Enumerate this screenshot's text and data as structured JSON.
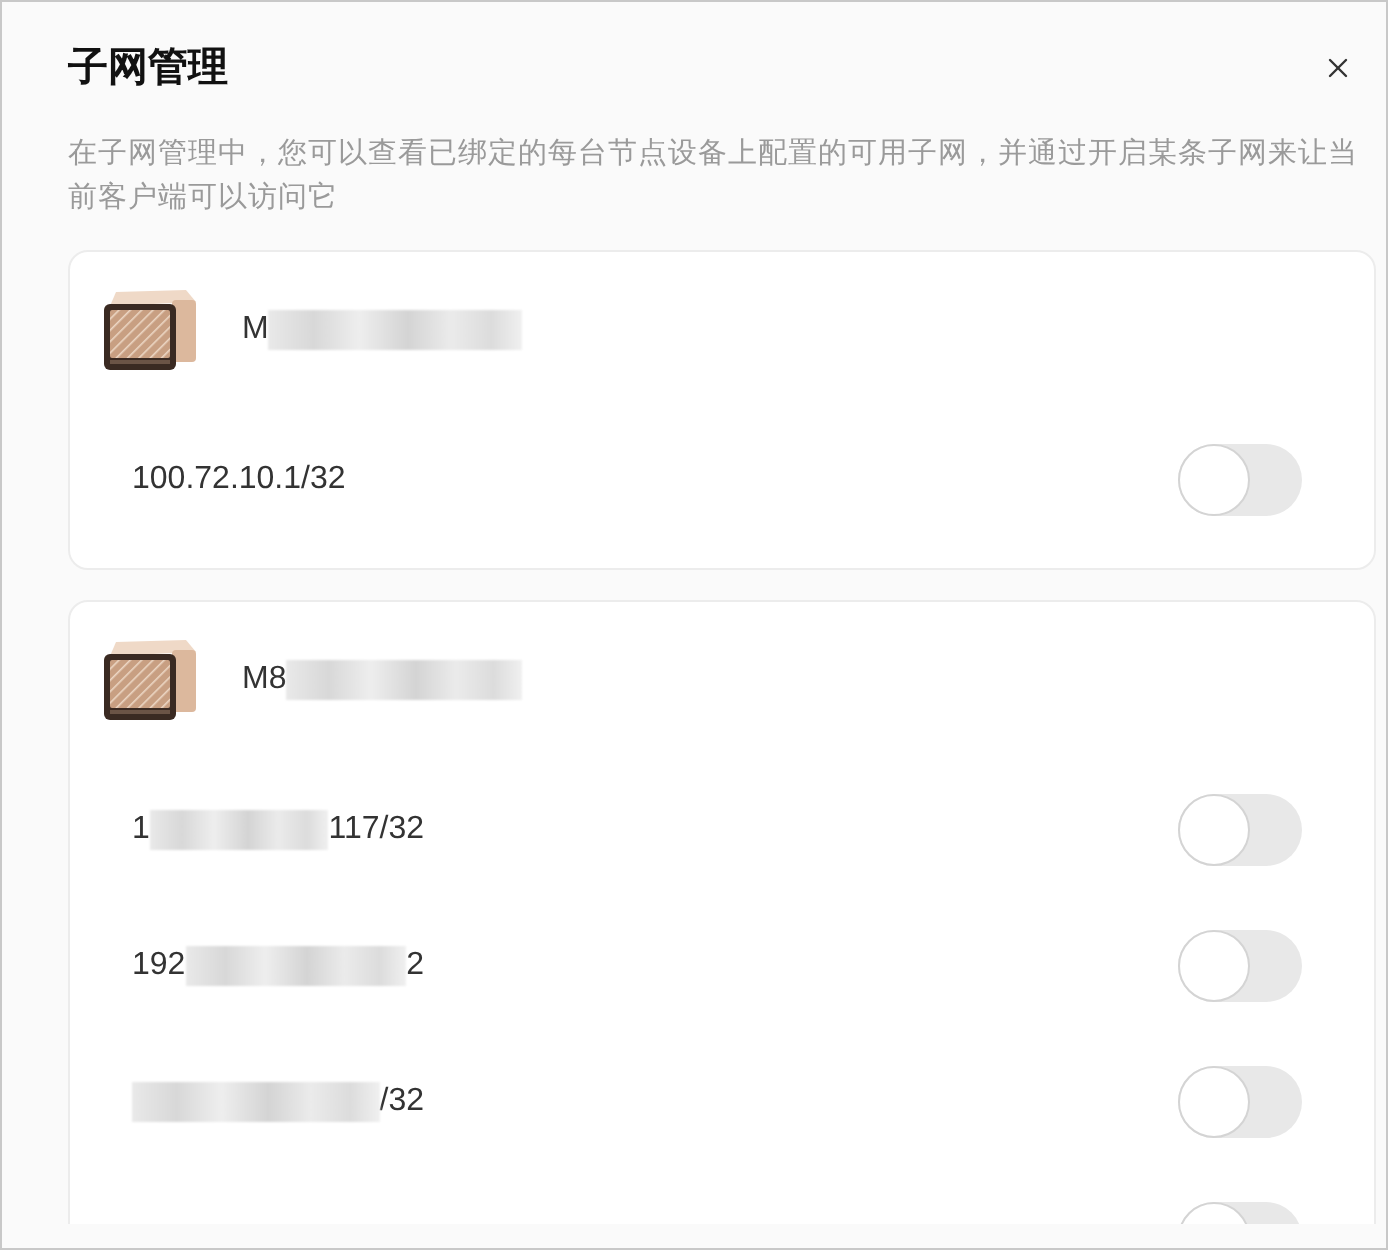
{
  "dialog": {
    "title": "子网管理",
    "description": "在子网管理中，您可以查看已绑定的每台节点设备上配置的可用子网，并通过开启某条子网来让当前客户端可以访问它"
  },
  "devices": [
    {
      "name": [
        {
          "kind": "text",
          "text": "M"
        },
        {
          "kind": "blur"
        }
      ],
      "subnets": [
        {
          "address": [
            {
              "kind": "text",
              "text": "100.72.10.1/32"
            }
          ],
          "on": false
        }
      ]
    },
    {
      "name": [
        {
          "kind": "text",
          "text": "M8"
        },
        {
          "kind": "blur"
        }
      ],
      "subnets": [
        {
          "address": [
            {
              "kind": "text",
              "text": "1"
            },
            {
              "kind": "blur"
            },
            {
              "kind": "text",
              "text": "117/32"
            }
          ],
          "on": false
        },
        {
          "address": [
            {
              "kind": "text",
              "text": "192"
            },
            {
              "kind": "blur"
            },
            {
              "kind": "text",
              "text": "2"
            }
          ],
          "on": false
        },
        {
          "address": [
            {
              "kind": "blur"
            },
            {
              "kind": "text",
              "text": "/32"
            }
          ],
          "on": false
        },
        {
          "on": false
        }
      ]
    }
  ]
}
